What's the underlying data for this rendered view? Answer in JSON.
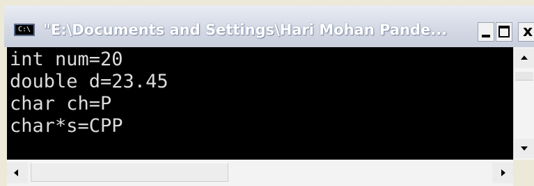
{
  "window": {
    "title": "\"E:\\Documents and Settings\\Hari Mohan Pande...",
    "app_icon_text": "C:\\",
    "controls": {
      "close_label": "x"
    }
  },
  "console": {
    "lines": [
      "int num=20",
      "double d=23.45",
      "char ch=P",
      "char*s=CPP"
    ],
    "background_color": "#000000",
    "text_color": "#dcdcdc"
  },
  "icons": {
    "app": "console-app-icon",
    "minimize": "minimize-icon",
    "maximize": "maximize-icon",
    "close": "close-icon",
    "scroll_up": "arrow-up-icon",
    "scroll_down": "arrow-down-icon",
    "scroll_left": "arrow-left-icon",
    "scroll_right": "arrow-right-icon"
  }
}
